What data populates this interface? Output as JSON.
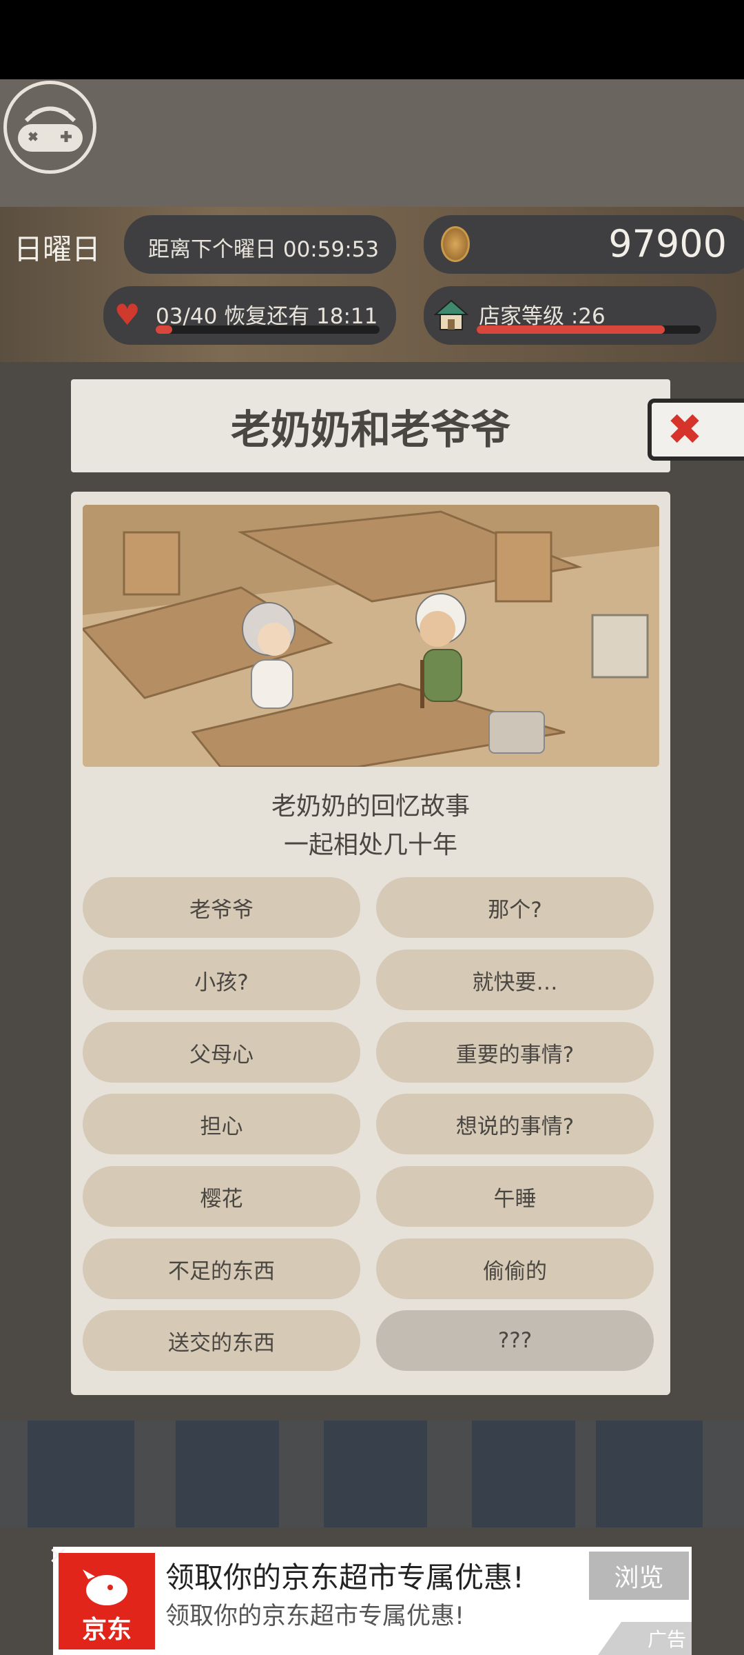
{
  "hud": {
    "weekday": "日曜日",
    "next_day_text": "距离下个曜日 00:59:53",
    "coins": "97900",
    "stamina_text": "03/40  恢复还有  18:11",
    "stamina_fraction": 0.075,
    "shop_level_text": "店家等级 :26",
    "shop_level_fraction": 0.84
  },
  "dialog": {
    "title": "老奶奶和老爷爷",
    "story_line1": "老奶奶的回忆故事",
    "story_line2": "一起相处几十年",
    "options": [
      {
        "label": "老爷爷"
      },
      {
        "label": "那个?"
      },
      {
        "label": "小孩?"
      },
      {
        "label": "就快要…"
      },
      {
        "label": "父母心"
      },
      {
        "label": "重要的事情?"
      },
      {
        "label": "担心"
      },
      {
        "label": "想说的事情?"
      },
      {
        "label": "樱花"
      },
      {
        "label": "午睡"
      },
      {
        "label": "不足的东西"
      },
      {
        "label": "偷偷的"
      },
      {
        "label": "送交的东西"
      },
      {
        "label": "???"
      }
    ]
  },
  "ad": {
    "brand": "京东",
    "title": "领取你的京东超市专属优惠!",
    "subtitle": "领取你的京东超市专属优惠!",
    "button": "浏览",
    "tag": "广告",
    "close": "✕"
  },
  "colors": {
    "accent_red": "#d6332a",
    "option_bg": "#d6cab7",
    "panel_bg": "#e6e2da",
    "jd_red": "#e1251b"
  }
}
